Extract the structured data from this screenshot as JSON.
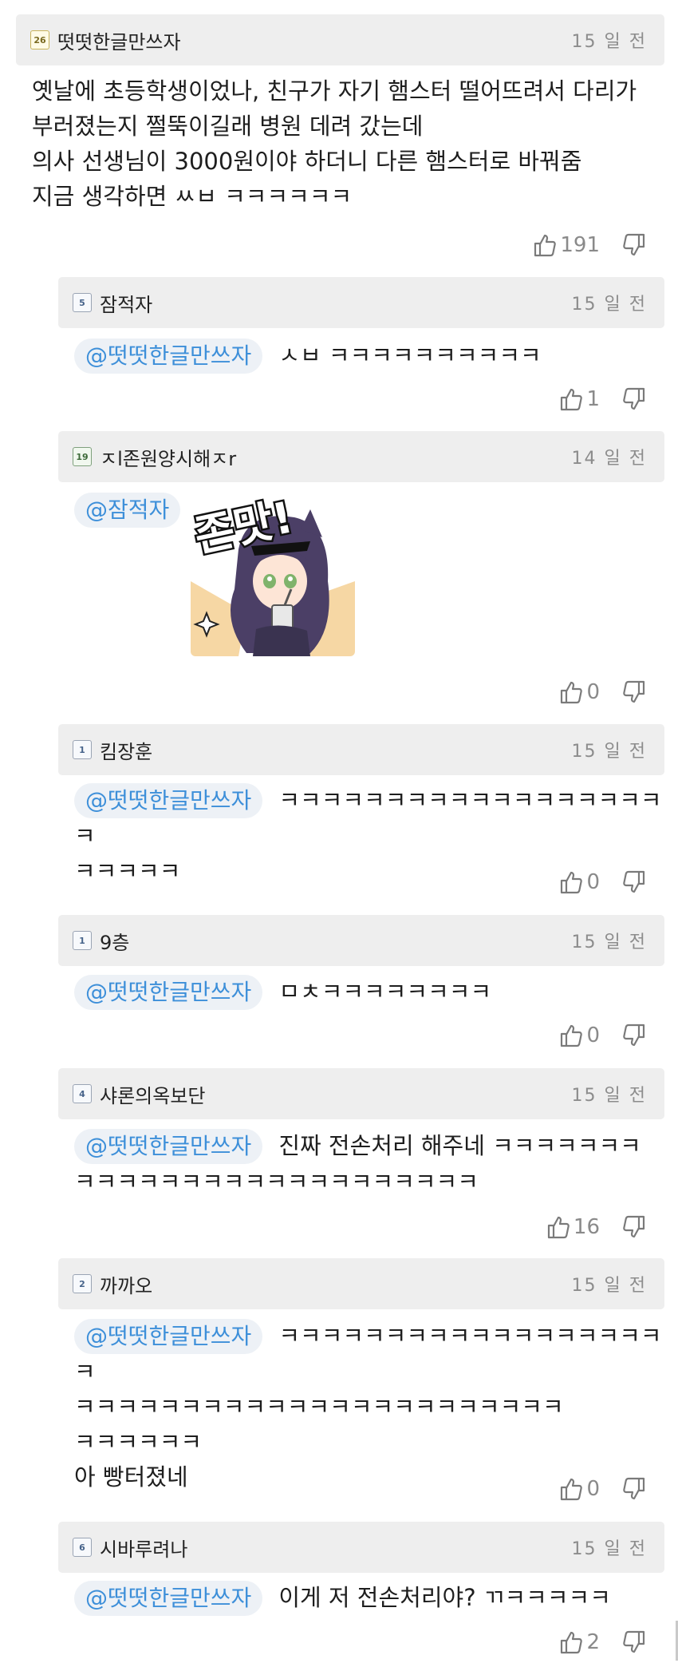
{
  "comments": [
    {
      "level": "26",
      "nickname": "떳떳한글만쓰자",
      "date": "15 일 전",
      "mention": "",
      "text": "옛날에 초등학생이었나, 친구가 자기 햄스터 떨어뜨려서 다리가\n부러졌는지 쩔뚝이길래 병원 데려 갔는데\n의사 선생님이 3000원이야 하더니 다른 햄스터로 바꿔줌\n지금 생각하면 ㅆㅂ ㅋㅋㅋㅋㅋㅋ",
      "likes": "191"
    },
    {
      "level": "5",
      "nickname": "잠적자",
      "date": "15 일 전",
      "mention": "@떳떳한글만쓰자",
      "text": "ㅅㅂ ㅋㅋㅋㅋㅋㅋㅋㅋㅋㅋ",
      "likes": "1"
    },
    {
      "level": "19",
      "nickname": "ㅈl존원양시해ㅈr",
      "date": "14 일 전",
      "mention": "@잠적자",
      "sticker_text": "존맛!",
      "likes": "0"
    },
    {
      "level": "1",
      "nickname": "킴장훈",
      "date": "15 일 전",
      "mention": "@떳떳한글만쓰자",
      "text": "ㅋㅋㅋㅋㅋㅋㅋㅋㅋㅋㅋㅋㅋㅋㅋㅋㅋㅋㅋ\nㅋㅋㅋㅋㅋ",
      "likes": "0"
    },
    {
      "level": "1",
      "nickname": "9층",
      "date": "15 일 전",
      "mention": "@떳떳한글만쓰자",
      "text": "ㅁㅊㅋㅋㅋㅋㅋㅋㅋㅋ",
      "likes": "0"
    },
    {
      "level": "4",
      "nickname": "샤론의옥보단",
      "date": "15 일 전",
      "mention": "@떳떳한글만쓰자",
      "text": "진짜 전손처리 해주네 ㅋㅋㅋㅋㅋㅋㅋ\nㅋㅋㅋㅋㅋㅋㅋㅋㅋㅋㅋㅋㅋㅋㅋㅋㅋㅋㅋ",
      "likes": "16"
    },
    {
      "level": "2",
      "nickname": "까까오",
      "date": "15 일 전",
      "mention": "@떳떳한글만쓰자",
      "text": "ㅋㅋㅋㅋㅋㅋㅋㅋㅋㅋㅋㅋㅋㅋㅋㅋㅋㅋㅋ\nㅋㅋㅋㅋㅋㅋㅋㅋㅋㅋㅋㅋㅋㅋㅋㅋㅋㅋㅋㅋㅋㅋㅋ\nㅋㅋㅋㅋㅋㅋ\n아 빵터졌네",
      "likes": "0"
    },
    {
      "level": "6",
      "nickname": "시바루려나",
      "date": "15 일 전",
      "mention": "@떳떳한글만쓰자",
      "text": "이게 저 전손처리야? ㄲㅋㅋㅋㅋㅋ",
      "likes": "2"
    }
  ],
  "colors": {
    "header_bg": "#eeeeee",
    "mention_text": "#3d8fd9",
    "mention_bg": "#edf1f6",
    "date": "#8c8c8c"
  },
  "icons": {
    "like": "thumbs-up-icon",
    "dislike": "thumbs-down-icon",
    "level": "level-badge-icon"
  }
}
